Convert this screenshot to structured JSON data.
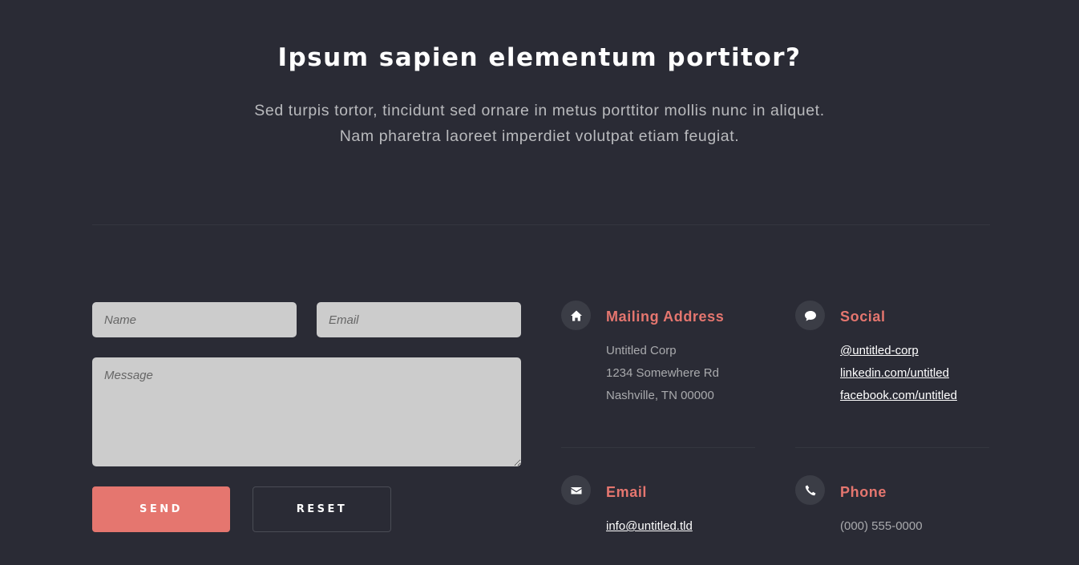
{
  "header": {
    "title": "Ipsum sapien elementum portitor?",
    "subtitle_line1": "Sed turpis tortor, tincidunt sed ornare in metus porttitor mollis nunc in aliquet.",
    "subtitle_line2": "Nam pharetra laoreet imperdiet volutpat etiam feugiat."
  },
  "form": {
    "name_placeholder": "Name",
    "email_placeholder": "Email",
    "message_placeholder": "Message",
    "send_label": "SEND",
    "reset_label": "RESET"
  },
  "contact": {
    "mailing": {
      "title": "Mailing Address",
      "icon": "home-icon",
      "lines": [
        "Untitled Corp",
        "1234 Somewhere Rd",
        "Nashville, TN 00000"
      ]
    },
    "social": {
      "title": "Social",
      "icon": "chat-bubble-icon",
      "links": [
        "@untitled-corp",
        "linkedin.com/untitled",
        "facebook.com/untitled"
      ]
    },
    "email": {
      "title": "Email",
      "icon": "envelope-icon",
      "link": "info@untitled.tld"
    },
    "phone": {
      "title": "Phone",
      "icon": "phone-icon",
      "number": "(000) 555-0000"
    }
  },
  "colors": {
    "background": "#2a2b35",
    "accent": "#e5766f",
    "field_bg": "#cccccc"
  }
}
